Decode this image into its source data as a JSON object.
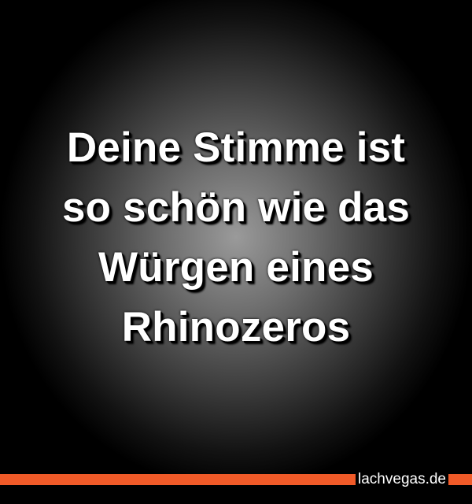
{
  "quote": {
    "lines": [
      "Deine Stimme ist",
      "so schön wie das",
      "Würgen eines",
      "Rhinozeros"
    ],
    "text_color": "#ffffff"
  },
  "footer": {
    "brand": "lachvegas.de",
    "accent_color": "#f05a28"
  }
}
